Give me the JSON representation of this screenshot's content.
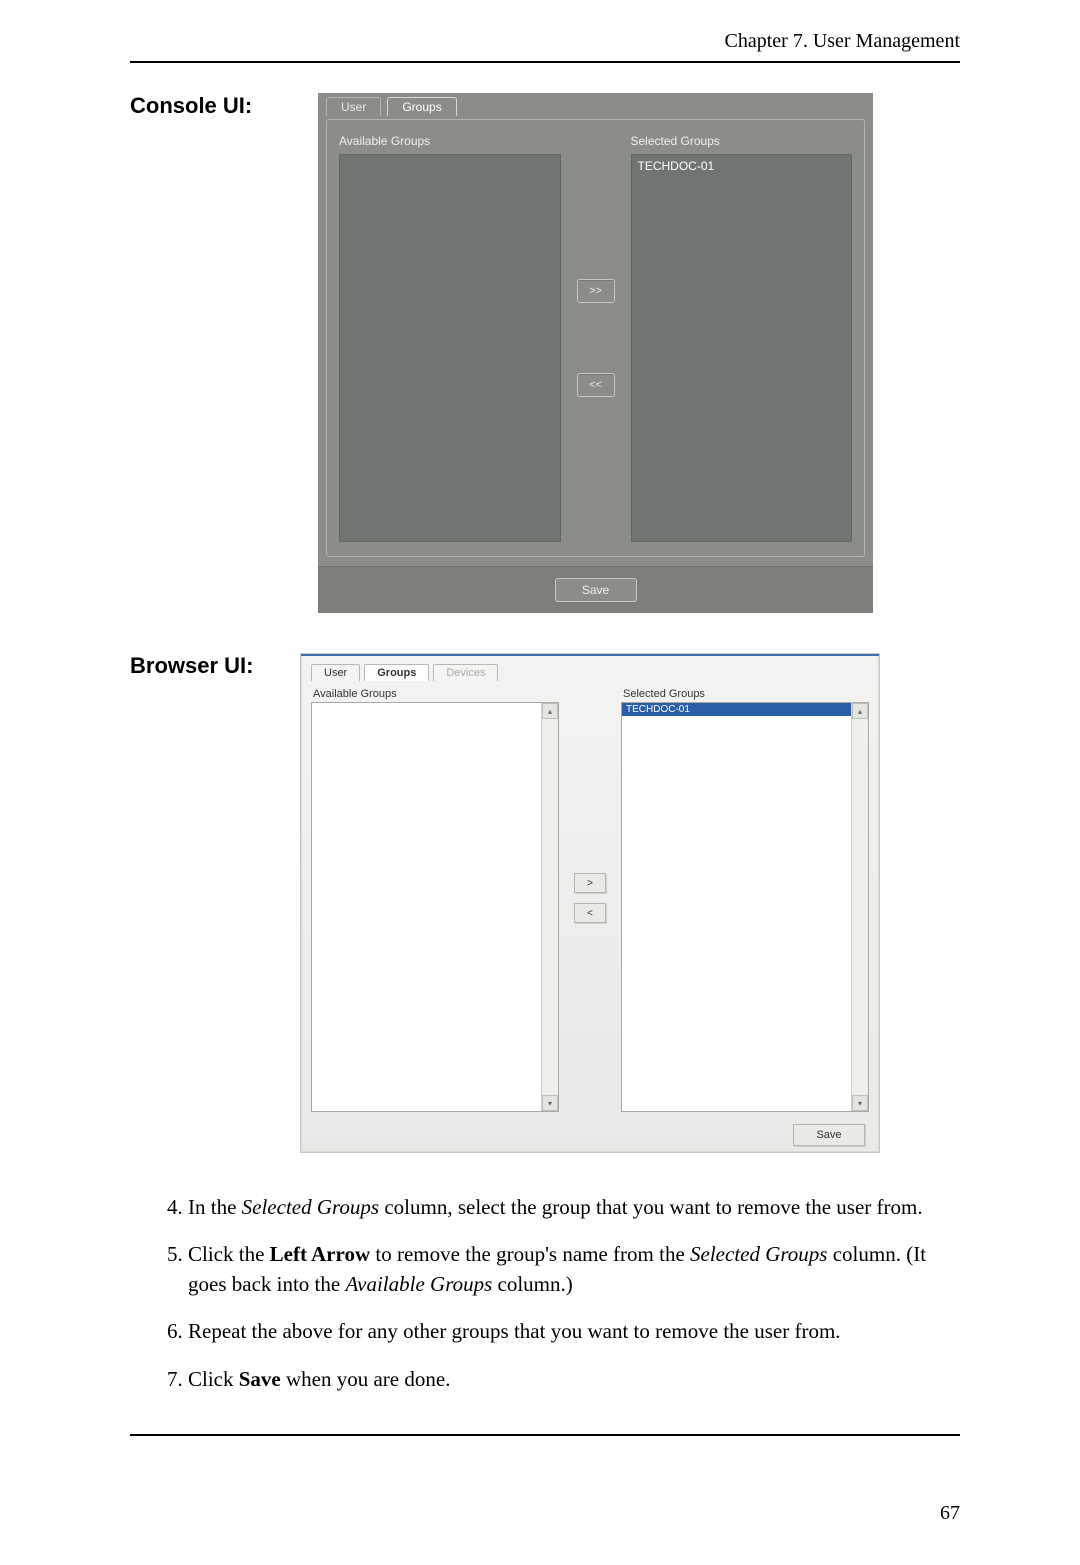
{
  "header": {
    "chapter": "Chapter 7. User Management"
  },
  "labels": {
    "console": "Console UI:",
    "browser": "Browser UI:"
  },
  "console": {
    "tabs": {
      "user": "User",
      "groups": "Groups"
    },
    "available_label": "Available Groups",
    "selected_label": "Selected Groups",
    "selected_item": "TECHDOC-01",
    "move_right": ">>",
    "move_left": "<<",
    "save": "Save"
  },
  "browser": {
    "tabs": {
      "user": "User",
      "groups": "Groups",
      "devices": "Devices"
    },
    "available_label": "Available Groups",
    "selected_label": "Selected Groups",
    "selected_item": "TECHDOC-01",
    "move_right": ">",
    "move_left": "<",
    "save": "Save"
  },
  "steps": {
    "s4a": "In the ",
    "s4b": "Selected Groups",
    "s4c": " column, select the group that you want to remove the user from.",
    "s5a": "Click the ",
    "s5b": "Left Arrow",
    "s5c": " to remove the group's name from the ",
    "s5d": "Selected Groups",
    "s5e": " column. (It goes back into the ",
    "s5f": "Available Groups",
    "s5g": " column.)",
    "s6": "Repeat the above for any other groups that you want to remove the user from.",
    "s7a": "Click ",
    "s7b": "Save",
    "s7c": " when you are done."
  },
  "page_number": "67"
}
